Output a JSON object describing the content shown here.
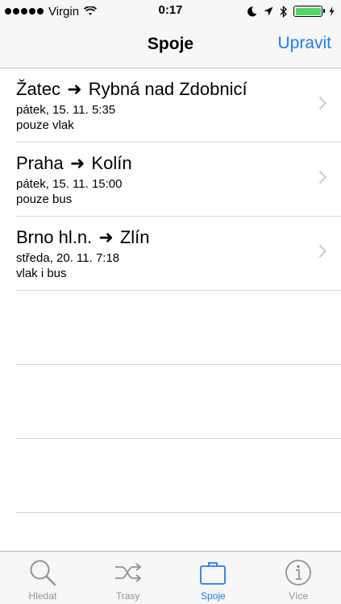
{
  "status_bar": {
    "carrier": "Virgin",
    "time": "0:17",
    "battery_level": 1.0
  },
  "nav": {
    "title": "Spoje",
    "edit_label": "Upravit"
  },
  "connections": [
    {
      "from": "Žatec",
      "arrow": "➜",
      "to": "Rybná nad Zdobnicí",
      "date": "pátek, 15. 11. 5:35",
      "type": "pouze vlak"
    },
    {
      "from": "Praha",
      "arrow": "➜",
      "to": "Kolín",
      "date": "pátek, 15. 11. 15:00",
      "type": "pouze bus"
    },
    {
      "from": "Brno hl.n.",
      "arrow": "➜",
      "to": "Zlín",
      "date": "středa, 20. 11. 7:18",
      "type": "vlak i bus"
    }
  ],
  "tabs": [
    {
      "label": "Hledat",
      "icon": "search-icon"
    },
    {
      "label": "Trasy",
      "icon": "shuffle-icon"
    },
    {
      "label": "Spoje",
      "icon": "briefcase-icon",
      "active": true
    },
    {
      "label": "Více",
      "icon": "info-icon"
    }
  ],
  "colors": {
    "accent": "#1f7bf2",
    "inactive_tab": "#929292",
    "battery": "#4cd964"
  }
}
